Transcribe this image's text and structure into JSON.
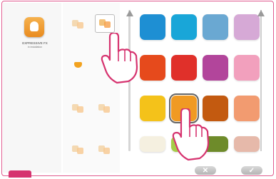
{
  "app": {
    "title": "EXPRESSIVE FX",
    "subtitle": "in installation"
  },
  "tools": [
    {
      "name": "tool-layers",
      "variant": "light",
      "selected": false
    },
    {
      "name": "tool-fill",
      "variant": "normal",
      "selected": true
    },
    {
      "name": "tool-basket",
      "variant": "basket",
      "selected": false
    },
    {
      "name": "tool-brush-a",
      "variant": "light",
      "selected": false
    },
    {
      "name": "tool-brush-b",
      "variant": "light",
      "selected": false
    },
    {
      "name": "tool-small-a",
      "variant": "light",
      "selected": false
    },
    {
      "name": "tool-small-b",
      "variant": "light",
      "selected": false
    }
  ],
  "palette": {
    "rows": [
      [
        "#1e8fd3",
        "#19a6d8",
        "#6aa8d2",
        "#d6a9d6"
      ],
      [
        "#e64a1c",
        "#e0302a",
        "#b2459b",
        "#f2a0bd"
      ],
      [
        "#f4c21a",
        "#f09a23",
        "#c35a10",
        "#f29b70"
      ],
      [
        "#f5f0e0",
        "#a6cd48",
        "#6e8b2a",
        "#e6b9aa"
      ]
    ],
    "selected": {
      "row": 2,
      "col": 1
    }
  },
  "buttons": {
    "cancel_label": "✕",
    "confirm_label": "✓"
  }
}
